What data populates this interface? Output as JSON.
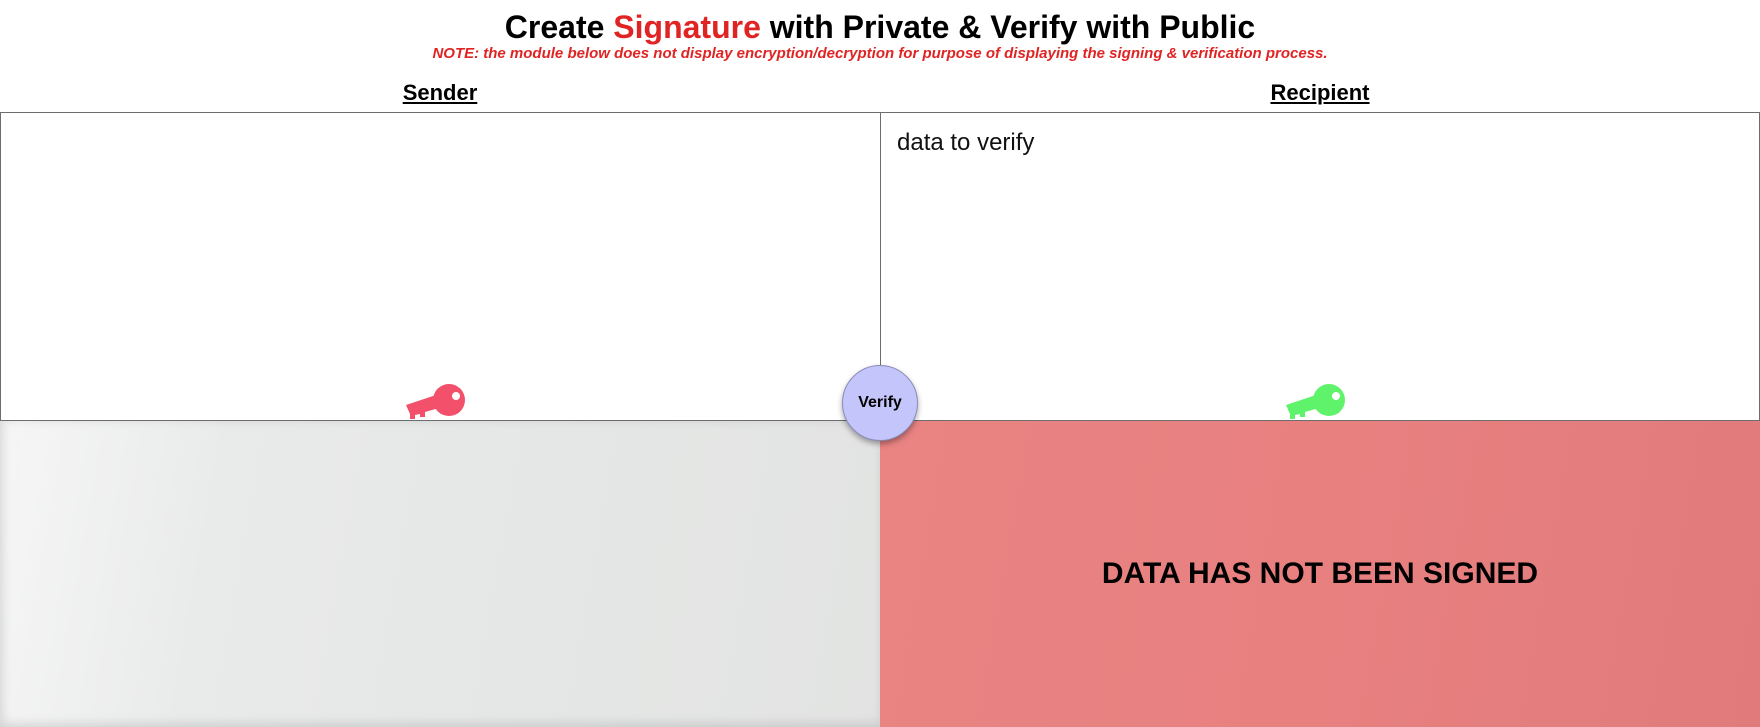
{
  "header": {
    "title_prefix": "Create ",
    "title_accent": "Signature",
    "title_suffix": " with Private & Verify with Public",
    "note": "NOTE: the module below does not display encryption/decryption for purpose of displaying the signing & verification process."
  },
  "sender": {
    "heading": "Sender",
    "textarea_value": "",
    "key_icon": "key-icon",
    "key_color": "#f2506b"
  },
  "recipient": {
    "heading": "Recipient",
    "textarea_placeholder": "data to verify",
    "key_icon": "key-icon",
    "key_color": "#5ff36b",
    "status_text": "DATA HAS NOT BEEN SIGNED",
    "status_color": "#e88080"
  },
  "verify_button": {
    "label": "Verify",
    "color": "#c3c5fb"
  },
  "colors": {
    "accent": "#e02424"
  }
}
